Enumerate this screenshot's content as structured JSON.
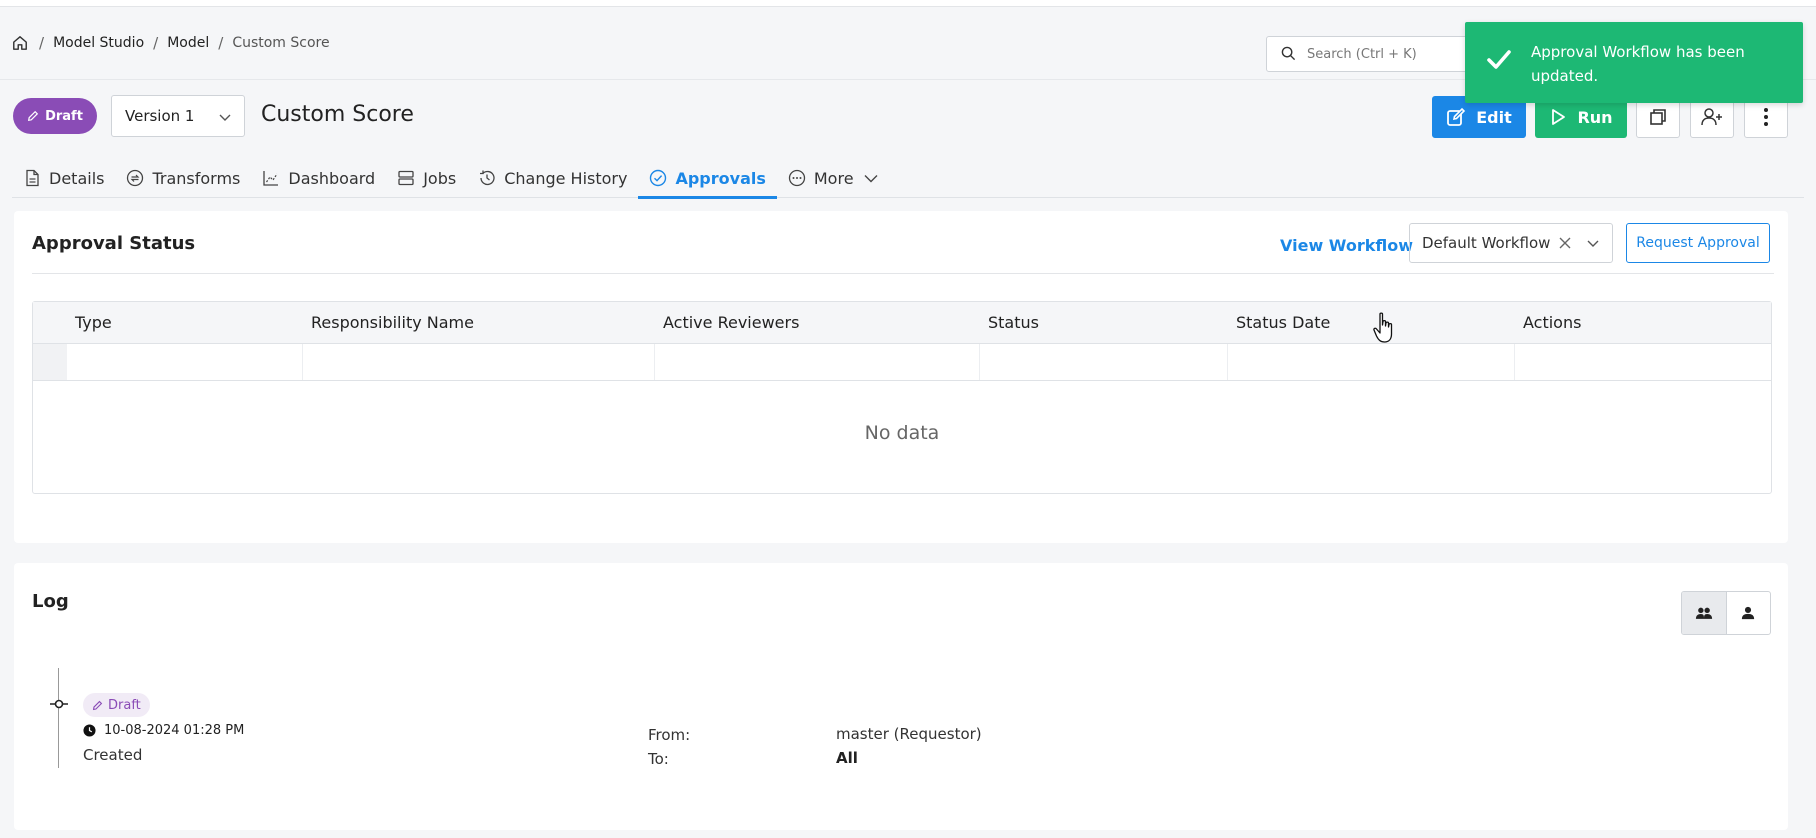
{
  "breadcrumb": {
    "items": [
      "Model Studio",
      "Model"
    ],
    "current": "Custom Score"
  },
  "search": {
    "placeholder": "Search (Ctrl + K)"
  },
  "toast": {
    "message": "Approval Workflow has been updated."
  },
  "header": {
    "status": "Draft",
    "version": "Version 1",
    "title": "Custom Score",
    "edit_label": "Edit",
    "run_label": "Run"
  },
  "tabs": [
    {
      "label": "Details",
      "icon": "document-icon"
    },
    {
      "label": "Transforms",
      "icon": "transforms-icon"
    },
    {
      "label": "Dashboard",
      "icon": "chart-icon"
    },
    {
      "label": "Jobs",
      "icon": "jobs-icon"
    },
    {
      "label": "Change History",
      "icon": "history-icon"
    },
    {
      "label": "Approvals",
      "icon": "check-circle-icon",
      "active": true
    },
    {
      "label": "More",
      "icon": "more-circle-icon"
    }
  ],
  "approval": {
    "title": "Approval Status",
    "view_workflow": "View Workflow",
    "workflow_select": "Default Workflow",
    "request_button": "Request Approval",
    "columns": [
      "Type",
      "Responsibility Name",
      "Active Reviewers",
      "Status",
      "Status Date",
      "Actions"
    ],
    "empty_text": "No data"
  },
  "log": {
    "title": "Log",
    "entry": {
      "status": "Draft",
      "timestamp": "10-08-2024 01:28 PM",
      "action": "Created",
      "from_label": "From:",
      "from_value": "master (Requestor)",
      "to_label": "To:",
      "to_value": "All"
    }
  },
  "colors": {
    "primary": "#1b87e6",
    "success": "#1db874",
    "draft": "#8a4cb6"
  }
}
